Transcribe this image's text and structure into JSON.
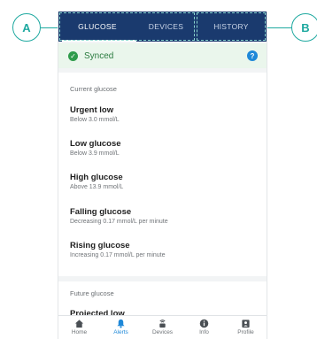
{
  "callouts": {
    "a": "A",
    "b": "B"
  },
  "tabs": [
    {
      "label": "GLUCOSE",
      "active": true
    },
    {
      "label": "DEVICES",
      "active": false
    },
    {
      "label": "HISTORY",
      "active": false
    }
  ],
  "status": {
    "label": "Synced",
    "help": "?"
  },
  "current": {
    "section_title": "Current glucose",
    "items": [
      {
        "title": "Urgent low",
        "subtitle": "Below 3.0 mmol/L"
      },
      {
        "title": "Low glucose",
        "subtitle": "Below 3.9 mmol/L"
      },
      {
        "title": "High glucose",
        "subtitle": "Above 13.9 mmol/L"
      },
      {
        "title": "Falling glucose",
        "subtitle": "Decreasing 0.17 mmol/L per minute"
      },
      {
        "title": "Rising glucose",
        "subtitle": "Increasing 0.17 mmol/L per minute"
      }
    ]
  },
  "future": {
    "section_title": "Future glucose",
    "items": [
      {
        "title": "Projected low"
      }
    ]
  },
  "nav": [
    {
      "label": "Home",
      "icon": "home-icon",
      "active": false
    },
    {
      "label": "Alerts",
      "icon": "bell-icon",
      "active": true
    },
    {
      "label": "Devices",
      "icon": "transmitter-icon",
      "active": false
    },
    {
      "label": "Info",
      "icon": "info-icon",
      "active": false
    },
    {
      "label": "Profile",
      "icon": "profile-icon",
      "active": false
    }
  ],
  "colors": {
    "accent": "#1fa9a0",
    "tab_bar": "#1a3a6e",
    "active_nav": "#1e88d8",
    "synced_bg": "#eaf6ec"
  }
}
